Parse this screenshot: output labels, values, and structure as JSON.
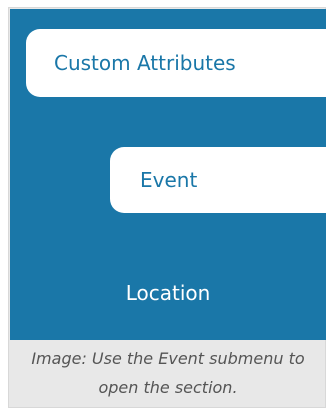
{
  "menu": {
    "items": [
      {
        "label": "Custom Attributes"
      },
      {
        "label": "Event"
      },
      {
        "label": "Location"
      }
    ]
  },
  "caption": {
    "line1": "Image: Use the Event submenu to",
    "line2": "open the section."
  },
  "colors": {
    "menu_background": "#1a77a8",
    "pill_background": "#ffffff",
    "caption_background": "#e8e8e8"
  }
}
